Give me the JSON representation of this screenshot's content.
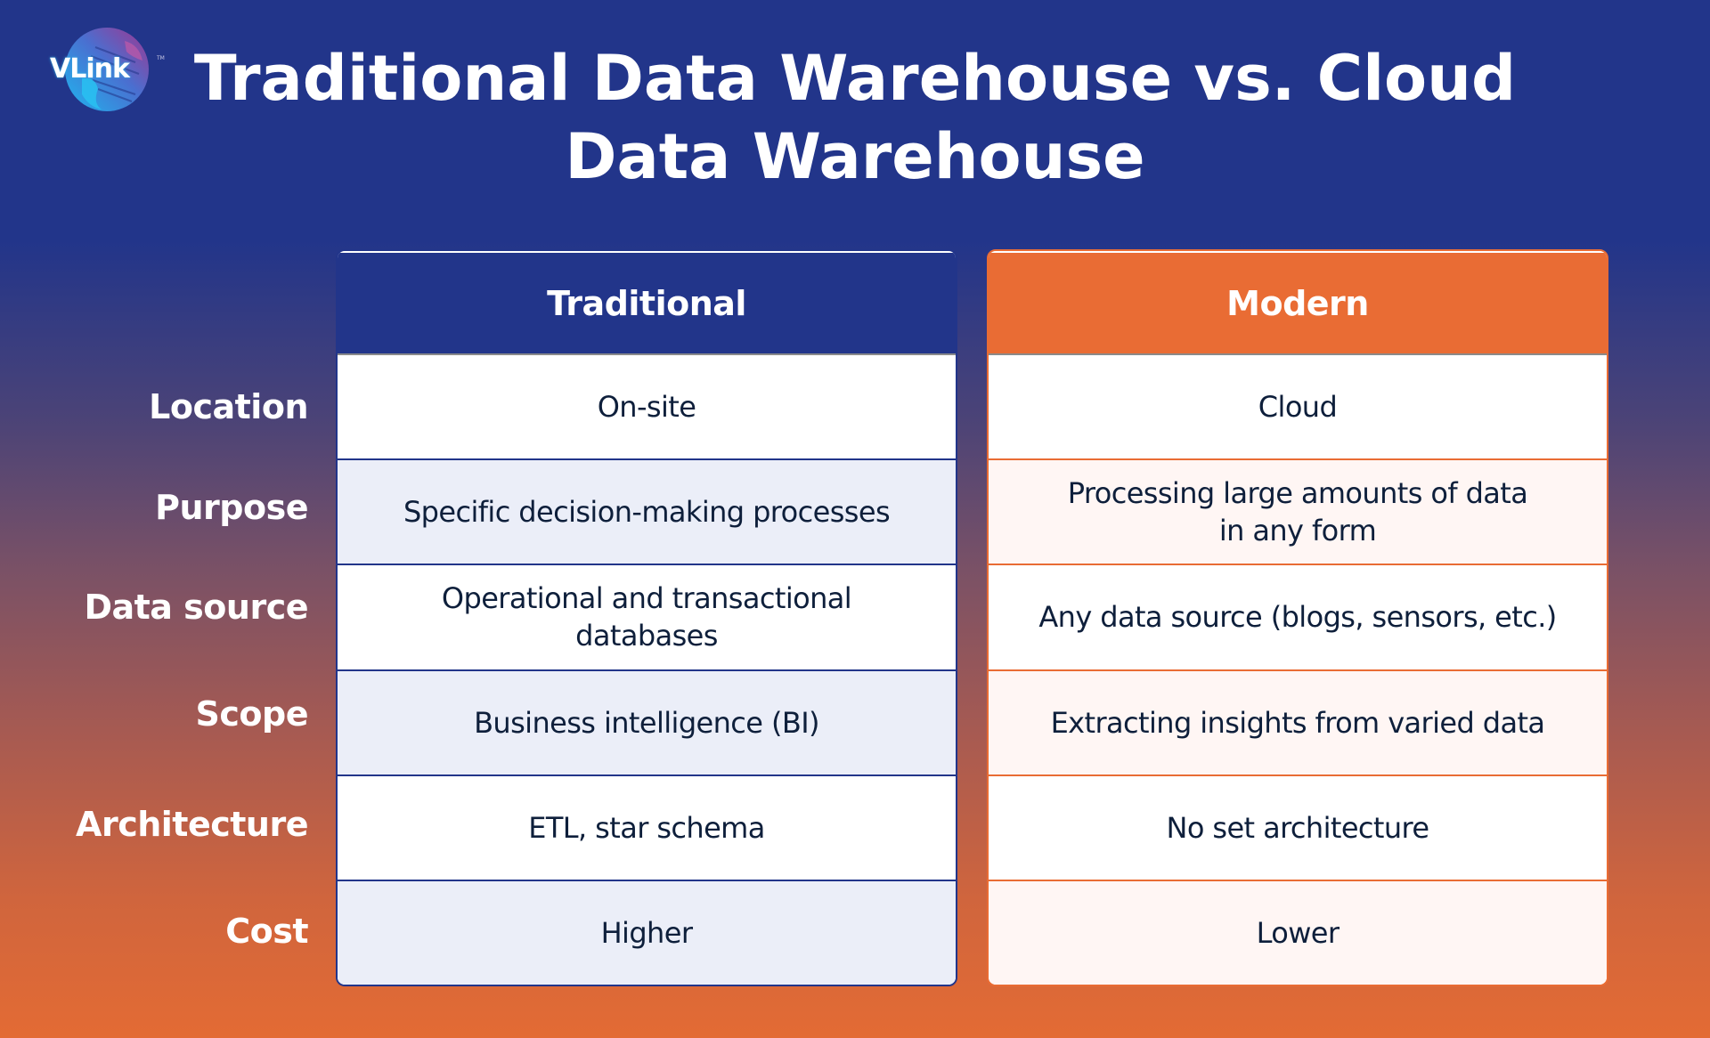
{
  "logo": {
    "text": "VLink",
    "tm": "TM"
  },
  "title": {
    "line1": "Traditional Data Warehouse vs. Cloud",
    "line2": "Data Warehouse"
  },
  "colors": {
    "navy": "#22358a",
    "orange": "#e96c34",
    "text_dark": "#0e1f3b",
    "trad_alt_row": "#ebeef8",
    "mod_alt_row": "#fff6f4"
  },
  "row_labels": [
    "Location",
    "Purpose",
    "Data source",
    "Scope",
    "Architecture",
    "Cost"
  ],
  "traditional": {
    "header": "Traditional",
    "cells": [
      "On-site",
      "Specific decision-making processes",
      "Operational and transactional databases",
      "Business intelligence (BI)",
      "ETL, star schema",
      "Higher"
    ]
  },
  "modern": {
    "header": "Modern",
    "cells": [
      "Cloud",
      "Processing large amounts of data in any form",
      "Any data source (blogs, sensors, etc.)",
      "Extracting insights from varied data",
      "No set architecture",
      "Lower"
    ]
  }
}
